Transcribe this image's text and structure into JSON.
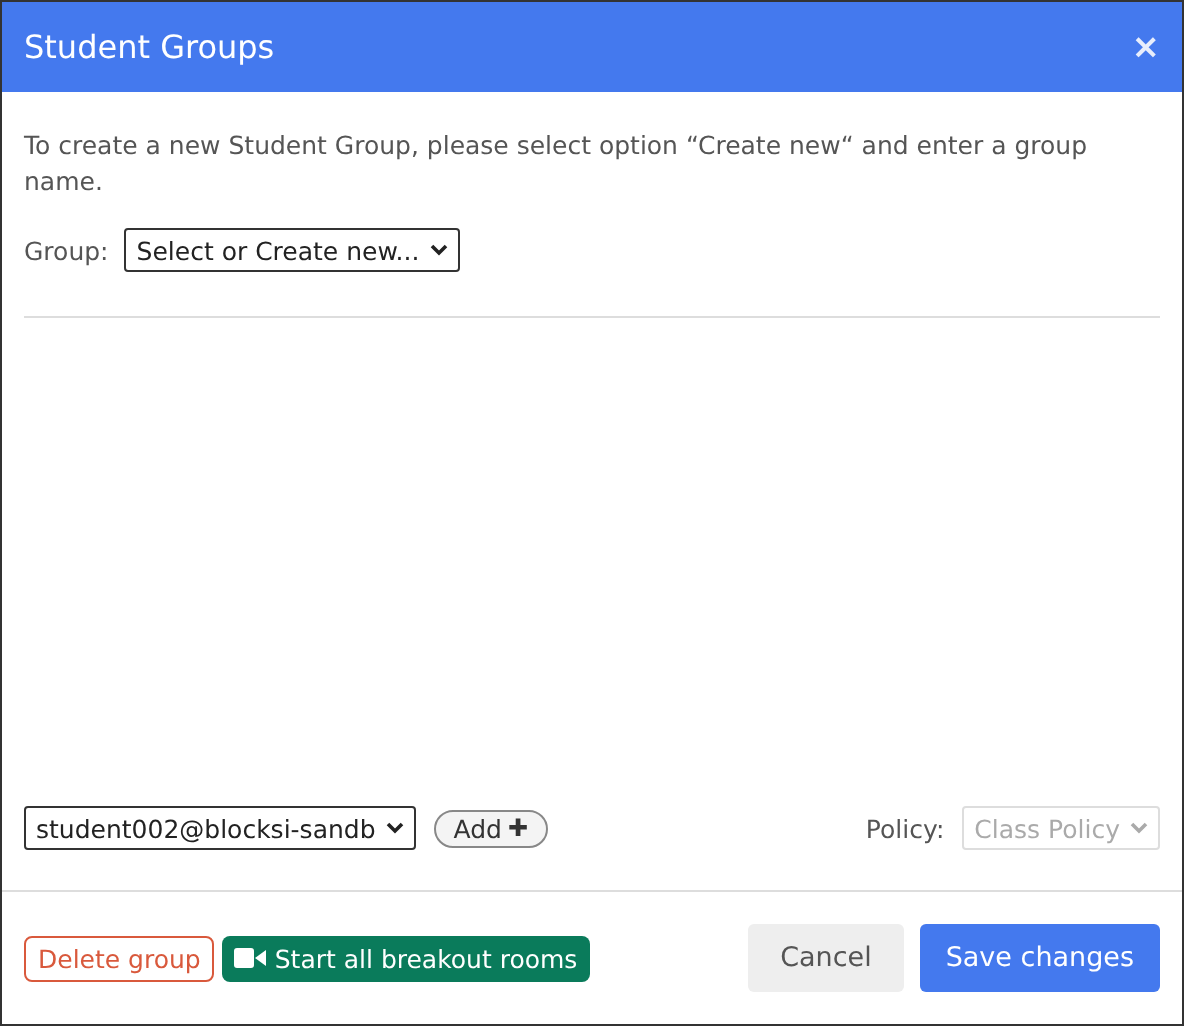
{
  "window": {
    "title": "Student Groups",
    "close": "×"
  },
  "instructions": "To create a new Student Group, please select option “Create new“ and enter a group name.",
  "group": {
    "label": "Group:",
    "value": "Select or Create new..."
  },
  "member": {
    "value": "student002@blocksi-sandb",
    "add_button": "Add",
    "add_icon": "✚"
  },
  "policy": {
    "label": "Policy:",
    "value": "Class Policy",
    "disabled": true
  },
  "footer": {
    "delete_button": "Delete group",
    "breakout_button": "Start all breakout rooms",
    "cancel_button": "Cancel",
    "save_button": "Save changes"
  }
}
